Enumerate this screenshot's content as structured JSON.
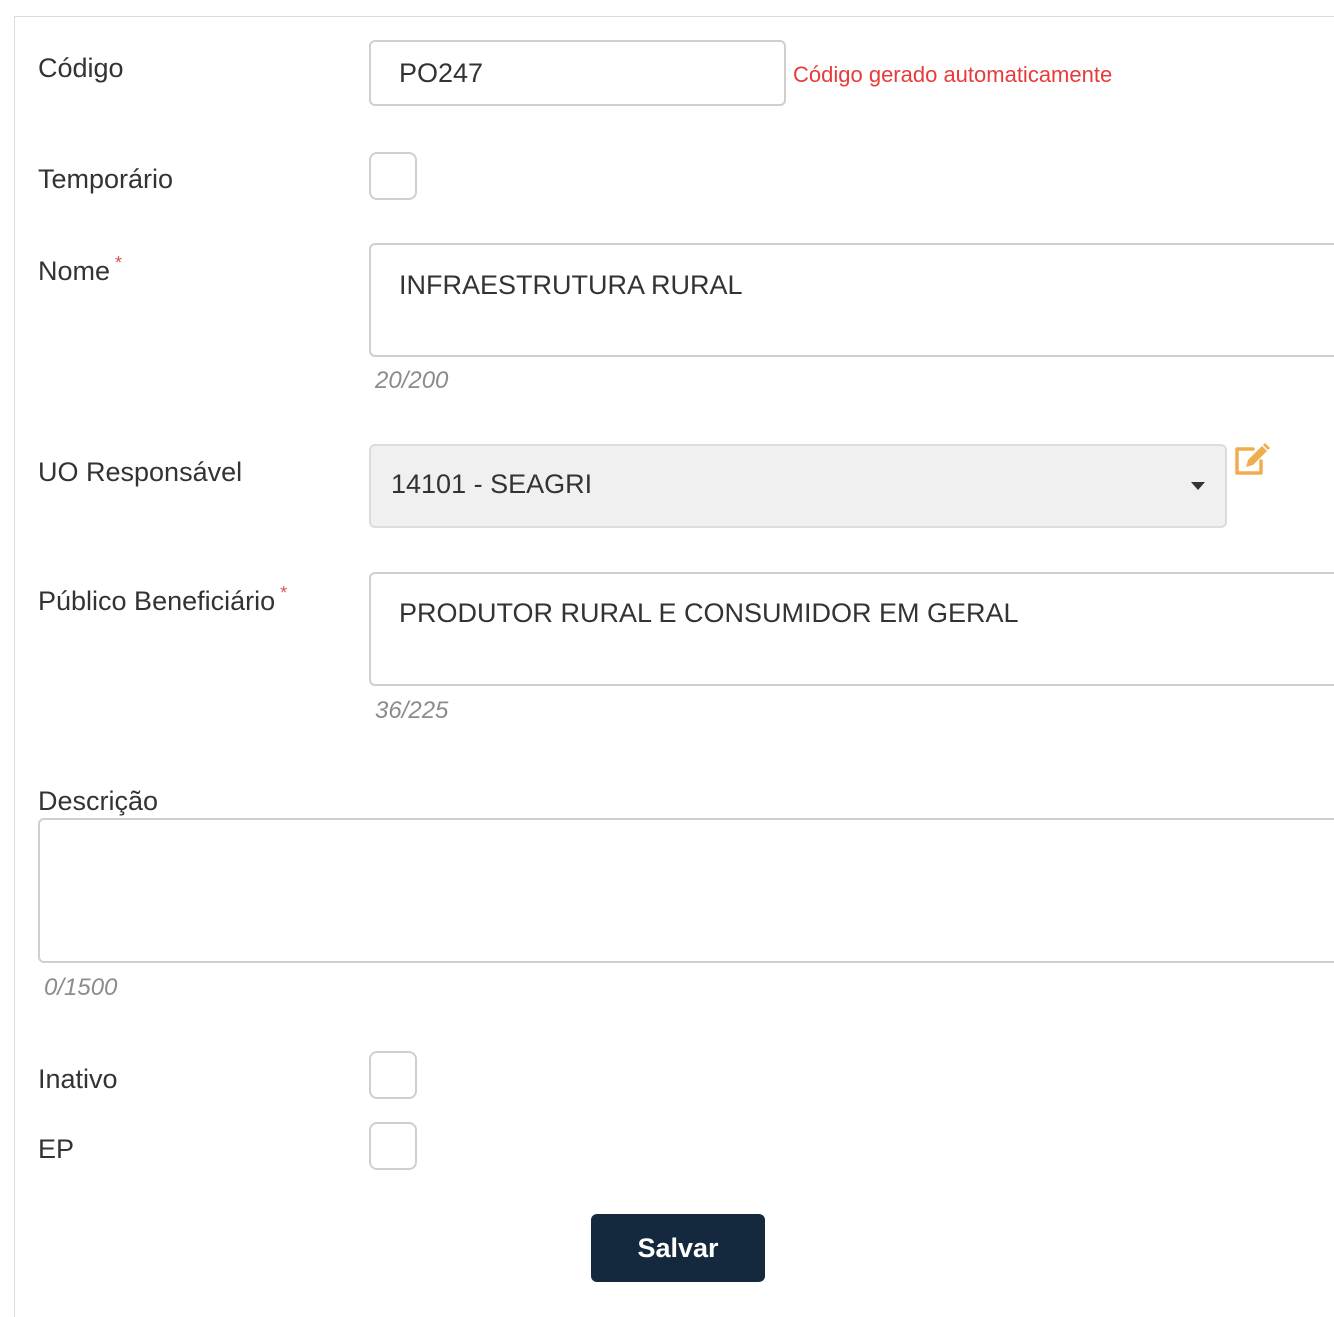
{
  "form": {
    "codigo": {
      "label": "Código",
      "value": "PO247",
      "hint": "Código gerado automaticamente"
    },
    "temporario": {
      "label": "Temporário",
      "checked": false
    },
    "nome": {
      "label": "Nome",
      "required_mark": "*",
      "value": "INFRAESTRUTURA RURAL",
      "counter": "20/200"
    },
    "uo_responsavel": {
      "label": "UO Responsável",
      "selected": "14101 - SEAGRI",
      "edit_icon": "edit-icon"
    },
    "publico_beneficiario": {
      "label": "Público Beneficiário",
      "required_mark": "*",
      "value": "PRODUTOR RURAL E CONSUMIDOR EM GERAL",
      "counter": "36/225"
    },
    "descricao": {
      "label": "Descrição",
      "value": "",
      "counter": "0/1500"
    },
    "inativo": {
      "label": "Inativo",
      "checked": false
    },
    "ep": {
      "label": "EP",
      "checked": false
    },
    "save_label": "Salvar"
  },
  "colors": {
    "hint": "#e83a3a",
    "required": "#d9534f",
    "button_bg": "#14293d",
    "edit_icon": "#f0ad4e"
  }
}
